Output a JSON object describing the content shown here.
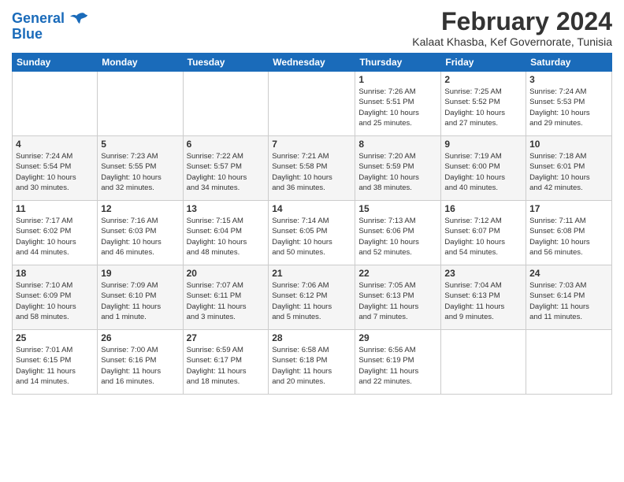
{
  "header": {
    "logo_line1": "General",
    "logo_line2": "Blue",
    "month_year": "February 2024",
    "location": "Kalaat Khasba, Kef Governorate, Tunisia"
  },
  "weekdays": [
    "Sunday",
    "Monday",
    "Tuesday",
    "Wednesday",
    "Thursday",
    "Friday",
    "Saturday"
  ],
  "weeks": [
    [
      {
        "day": "",
        "info": ""
      },
      {
        "day": "",
        "info": ""
      },
      {
        "day": "",
        "info": ""
      },
      {
        "day": "",
        "info": ""
      },
      {
        "day": "1",
        "info": "Sunrise: 7:26 AM\nSunset: 5:51 PM\nDaylight: 10 hours\nand 25 minutes."
      },
      {
        "day": "2",
        "info": "Sunrise: 7:25 AM\nSunset: 5:52 PM\nDaylight: 10 hours\nand 27 minutes."
      },
      {
        "day": "3",
        "info": "Sunrise: 7:24 AM\nSunset: 5:53 PM\nDaylight: 10 hours\nand 29 minutes."
      }
    ],
    [
      {
        "day": "4",
        "info": "Sunrise: 7:24 AM\nSunset: 5:54 PM\nDaylight: 10 hours\nand 30 minutes."
      },
      {
        "day": "5",
        "info": "Sunrise: 7:23 AM\nSunset: 5:55 PM\nDaylight: 10 hours\nand 32 minutes."
      },
      {
        "day": "6",
        "info": "Sunrise: 7:22 AM\nSunset: 5:57 PM\nDaylight: 10 hours\nand 34 minutes."
      },
      {
        "day": "7",
        "info": "Sunrise: 7:21 AM\nSunset: 5:58 PM\nDaylight: 10 hours\nand 36 minutes."
      },
      {
        "day": "8",
        "info": "Sunrise: 7:20 AM\nSunset: 5:59 PM\nDaylight: 10 hours\nand 38 minutes."
      },
      {
        "day": "9",
        "info": "Sunrise: 7:19 AM\nSunset: 6:00 PM\nDaylight: 10 hours\nand 40 minutes."
      },
      {
        "day": "10",
        "info": "Sunrise: 7:18 AM\nSunset: 6:01 PM\nDaylight: 10 hours\nand 42 minutes."
      }
    ],
    [
      {
        "day": "11",
        "info": "Sunrise: 7:17 AM\nSunset: 6:02 PM\nDaylight: 10 hours\nand 44 minutes."
      },
      {
        "day": "12",
        "info": "Sunrise: 7:16 AM\nSunset: 6:03 PM\nDaylight: 10 hours\nand 46 minutes."
      },
      {
        "day": "13",
        "info": "Sunrise: 7:15 AM\nSunset: 6:04 PM\nDaylight: 10 hours\nand 48 minutes."
      },
      {
        "day": "14",
        "info": "Sunrise: 7:14 AM\nSunset: 6:05 PM\nDaylight: 10 hours\nand 50 minutes."
      },
      {
        "day": "15",
        "info": "Sunrise: 7:13 AM\nSunset: 6:06 PM\nDaylight: 10 hours\nand 52 minutes."
      },
      {
        "day": "16",
        "info": "Sunrise: 7:12 AM\nSunset: 6:07 PM\nDaylight: 10 hours\nand 54 minutes."
      },
      {
        "day": "17",
        "info": "Sunrise: 7:11 AM\nSunset: 6:08 PM\nDaylight: 10 hours\nand 56 minutes."
      }
    ],
    [
      {
        "day": "18",
        "info": "Sunrise: 7:10 AM\nSunset: 6:09 PM\nDaylight: 10 hours\nand 58 minutes."
      },
      {
        "day": "19",
        "info": "Sunrise: 7:09 AM\nSunset: 6:10 PM\nDaylight: 11 hours\nand 1 minute."
      },
      {
        "day": "20",
        "info": "Sunrise: 7:07 AM\nSunset: 6:11 PM\nDaylight: 11 hours\nand 3 minutes."
      },
      {
        "day": "21",
        "info": "Sunrise: 7:06 AM\nSunset: 6:12 PM\nDaylight: 11 hours\nand 5 minutes."
      },
      {
        "day": "22",
        "info": "Sunrise: 7:05 AM\nSunset: 6:13 PM\nDaylight: 11 hours\nand 7 minutes."
      },
      {
        "day": "23",
        "info": "Sunrise: 7:04 AM\nSunset: 6:13 PM\nDaylight: 11 hours\nand 9 minutes."
      },
      {
        "day": "24",
        "info": "Sunrise: 7:03 AM\nSunset: 6:14 PM\nDaylight: 11 hours\nand 11 minutes."
      }
    ],
    [
      {
        "day": "25",
        "info": "Sunrise: 7:01 AM\nSunset: 6:15 PM\nDaylight: 11 hours\nand 14 minutes."
      },
      {
        "day": "26",
        "info": "Sunrise: 7:00 AM\nSunset: 6:16 PM\nDaylight: 11 hours\nand 16 minutes."
      },
      {
        "day": "27",
        "info": "Sunrise: 6:59 AM\nSunset: 6:17 PM\nDaylight: 11 hours\nand 18 minutes."
      },
      {
        "day": "28",
        "info": "Sunrise: 6:58 AM\nSunset: 6:18 PM\nDaylight: 11 hours\nand 20 minutes."
      },
      {
        "day": "29",
        "info": "Sunrise: 6:56 AM\nSunset: 6:19 PM\nDaylight: 11 hours\nand 22 minutes."
      },
      {
        "day": "",
        "info": ""
      },
      {
        "day": "",
        "info": ""
      }
    ]
  ]
}
